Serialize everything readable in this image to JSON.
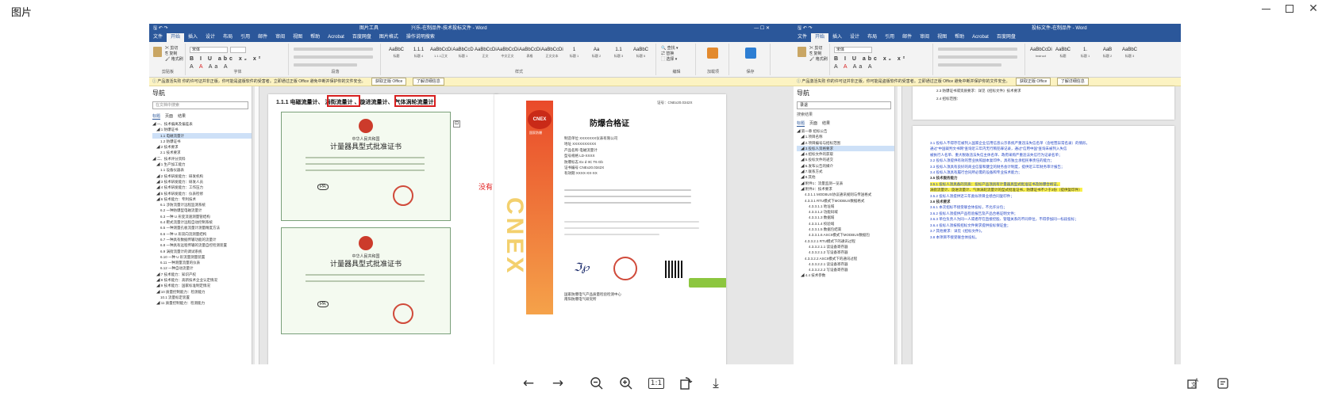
{
  "viewer": {
    "title": "图片",
    "toolbar": [
      "arrow-left-icon",
      "arrow-right-icon",
      "zoom-out-icon",
      "zoom-in-icon",
      "actual-size-icon",
      "rotate-icon",
      "download-icon"
    ],
    "actual_size_label": "1:1"
  },
  "word_left": {
    "title": "兴乐-在制品件-技术投标文件 - Word",
    "menu": [
      "文件",
      "开始",
      "插入",
      "设计",
      "布局",
      "引用",
      "邮件",
      "审阅",
      "视图",
      "帮助",
      "Acrobat",
      "百度网盘",
      "图片格式",
      "操作说明搜索"
    ],
    "active_menu": "开始",
    "font_name": "宋体",
    "ribbon_groups": [
      "剪贴板",
      "字体",
      "段落",
      "样式",
      "编辑",
      "加载项",
      "保存"
    ],
    "styles": [
      {
        "sample": "AaBbC",
        "name": "标题"
      },
      {
        "sample": "1.1.1",
        "name": "标题 4"
      },
      {
        "sample": "AaBbCcDi",
        "name": "1.1.1正文"
      },
      {
        "sample": "AaBbCcD",
        "name": "标题 1"
      },
      {
        "sample": "AaBbCcDi",
        "name": "正文"
      },
      {
        "sample": "AaBbCcDi",
        "name": "中文正文"
      },
      {
        "sample": "AaBbCcDi",
        "name": "表格"
      },
      {
        "sample": "AaBbCcDi",
        "name": "正文文本"
      },
      {
        "sample": "1",
        "name": "标题 1"
      },
      {
        "sample": "Aa",
        "name": "标题 2"
      },
      {
        "sample": "1.1",
        "name": "标题 3"
      },
      {
        "sample": "AaBbC",
        "name": "标题 5"
      }
    ],
    "notice": "产品激活失败  你的许可证并非正版，你可能是盗版软件的受害者。立即通过正版 Office 避免中断并保护你的文件安全。",
    "notice_btn1": "获取正版 Office",
    "notice_btn2": "了解详细信息",
    "nav": {
      "title": "导航",
      "search_placeholder": "在文档中搜索",
      "tabs": [
        "标题",
        "页面",
        "结果"
      ],
      "items": [
        {
          "text": "一、技术偏离及偏差表",
          "level": 0
        },
        {
          "text": "1 防爆证书",
          "level": 1
        },
        {
          "text": "1.1 电磁流量计",
          "level": 2,
          "hl": true
        },
        {
          "text": "1.2 防爆证书",
          "level": 2
        },
        {
          "text": "2 技术要求",
          "level": 1
        },
        {
          "text": "2.1 技术要求",
          "level": 2
        },
        {
          "text": "二、技术评分资料",
          "level": 0
        },
        {
          "text": "1 生产加工能力",
          "level": 1
        },
        {
          "text": "1.1 设备仪器表",
          "level": 2
        },
        {
          "text": "2 技术研发能力：研发机构",
          "level": 1
        },
        {
          "text": "3 技术研发能力：研发人员",
          "level": 1
        },
        {
          "text": "4 技术研发能力：工作压力",
          "level": 1
        },
        {
          "text": "5 技术研发能力：仪表检修",
          "level": 1
        },
        {
          "text": "6 技术能力：专利技术",
          "level": 1
        },
        {
          "text": "6.1 涉防流量计远程监测系统",
          "level": 2
        },
        {
          "text": "6.2 一种防爆型电磁流量计",
          "level": 2
        },
        {
          "text": "6.3 一种 U 形变流速测量管结构",
          "level": 2
        },
        {
          "text": "6.4 靶式流量计远程自动控制系统",
          "level": 2
        },
        {
          "text": "6.5 一种测量孔板流量计测量精度方法",
          "level": 2
        },
        {
          "text": "6.6 一种 U 形双向流测量结构",
          "level": 2
        },
        {
          "text": "6.7 一种具有数据传输功能的流量计",
          "level": 2
        },
        {
          "text": "6.8 一种具有远程传输的流量自控检测装置",
          "level": 2
        },
        {
          "text": "6.9 涡街流量计的调试系统",
          "level": 2
        },
        {
          "text": "6.10 一种 U 形流量测量装置",
          "level": 2
        },
        {
          "text": "6.11 一种测量流量的仪表",
          "level": 2
        },
        {
          "text": "6.12 一种自动流量计",
          "level": 2
        },
        {
          "text": "7 技术能力：知识产权",
          "level": 1
        },
        {
          "text": "8 技术能力：高新技术企业认定情况",
          "level": 1
        },
        {
          "text": "9 技术能力：国家标准制定情况",
          "level": 1
        },
        {
          "text": "10 质量控制能力：检测能力",
          "level": 1
        },
        {
          "text": "10.1 流量标定装置",
          "level": 2
        },
        {
          "text": "11 质量控制能力：检测能力",
          "level": 1
        }
      ]
    },
    "page1": {
      "heading_prefix": "1.1.1 电磁流量计、",
      "boxed1": "涡街流量计",
      "mid": "、旋进流量计、",
      "boxed2": "气体涡轮流量计",
      "cert_country": "中华人民共和国",
      "cert_title": "计量器具型式批准证书",
      "cert_mark": "PA"
    },
    "annotation": "没有",
    "page2": {
      "logo_text": "CNEX",
      "logo_sub": "国家防爆",
      "cert_no": "证号：CNEx20.0342X",
      "title": "防爆合格证",
      "rows": [
        {
          "k": "制造单位",
          "v": "XXXXXXX仪表有限公司"
        },
        {
          "k": "地址",
          "v": "XXXXXXXXXX"
        },
        {
          "k": "产品名称",
          "v": "电磁流量计"
        },
        {
          "k": "型号规格",
          "v": "LD-XXXX"
        },
        {
          "k": "防爆标志",
          "v": "Ex d IIC T6 Gb"
        },
        {
          "k": "证书编号",
          "v": "CNEx20.0342X"
        },
        {
          "k": "有效期",
          "v": "XXXX-XX-XX"
        }
      ],
      "org": "国家防爆电气产品质量检验检测中心",
      "org2": "南阳防爆电气研究所"
    }
  },
  "word_right": {
    "title": "投标文件-在制品件 - Word",
    "menu": [
      "文件",
      "开始",
      "插入",
      "设计",
      "布局",
      "引用",
      "邮件",
      "审阅",
      "视图",
      "帮助",
      "Acrobat",
      "百度网盘"
    ],
    "active_menu": "开始",
    "font_name": "宋体",
    "styles": [
      {
        "sample": "AaBbCcDi",
        "name": "Instruct"
      },
      {
        "sample": "AaBbC",
        "name": "标题"
      },
      {
        "sample": "1.",
        "name": "标题 1"
      },
      {
        "sample": "AaB",
        "name": "标题 2"
      },
      {
        "sample": "AaBbC",
        "name": "标题 3"
      }
    ],
    "notice": "产品激活失败  你的许可证并非正版，你可能是盗版软件的受害者。立即通过正版 Office 避免中断并保护你的文件安全。",
    "notice_btn1": "获取正版 Office",
    "notice_btn2": "了解详细信息",
    "nav": {
      "title": "导航",
      "search_value": "录退",
      "sub": "搜索结果",
      "tabs": [
        "标题",
        "页面",
        "结果"
      ],
      "items": [
        {
          "text": "第一章 招标公告",
          "level": 0
        },
        {
          "text": "1.项目名称",
          "level": 1
        },
        {
          "text": "2.项目编号与招标范围",
          "level": 1
        },
        {
          "text": "3.投标人资格要求",
          "level": 1,
          "hl": true
        },
        {
          "text": "4.招标文件的获取",
          "level": 1
        },
        {
          "text": "5.投标文件的递交",
          "level": 1
        },
        {
          "text": "6.发布公告的媒介",
          "level": 1
        },
        {
          "text": "7.联系方式",
          "level": 1
        },
        {
          "text": "8.其他",
          "level": 1
        },
        {
          "text": "附件1：流量监测一览表",
          "level": 1
        },
        {
          "text": "附件2：技术要求",
          "level": 1
        },
        {
          "text": "4.3.1.1 MODBUS协议通讯规则与传送格式",
          "level": 2
        },
        {
          "text": "4.3.3.1 RTU模式下MODBUS数据格式",
          "level": 2
        },
        {
          "text": "4.3.3.1.1 地址域",
          "level": 3
        },
        {
          "text": "4.3.3.1.2 功能码域",
          "level": 3
        },
        {
          "text": "4.3.3.1.3 数据域",
          "level": 3
        },
        {
          "text": "4.3.3.1.4 校验域",
          "level": 3
        },
        {
          "text": "4.3.3.1.5 数据包结束",
          "level": 3
        },
        {
          "text": "4.3.3.1.6 ASCII模式下MODBUS数据包",
          "level": 3
        },
        {
          "text": "4.3.3.2.1 RTU模式下的通讯过程",
          "level": 2
        },
        {
          "text": "4.3.3.2.1.1 读设备寄存器",
          "level": 3
        },
        {
          "text": "4.3.3.2.1.2 写设备寄存器",
          "level": 3
        },
        {
          "text": "4.3.3.2.2 ASCII模式下的通讯过程",
          "level": 2
        },
        {
          "text": "4.3.3.2.2.1 读设备寄存器",
          "level": 3
        },
        {
          "text": "4.3.3.2.2.2 写设备寄存器",
          "level": 3
        },
        {
          "text": "4.4 技术参数",
          "level": 1
        }
      ]
    },
    "doc_lines": [
      {
        "text": "2.3 防爆证书或资质要求：详见《招标文件》技术要求",
        "cls": ""
      },
      {
        "text": "2.4 招标范围：",
        "cls": ""
      },
      {
        "text": "3.1 投标人不得存在被列入国家企业信用信息公示系统严重违法失信名单（含经营异常名录）的情形。",
        "cls": "blue"
      },
      {
        "text": "通过“中国裁判文书网”查询近三年内无行贿犯罪记录，通过“信用中国”查询未被列入失信",
        "cls": "blue"
      },
      {
        "text": "被执行人名单、重大税收违法失信主体名单、政府采购严重违法失信行为记录名单；",
        "cls": "blue"
      },
      {
        "text": "3.2 投标人须提供有效的营业执照副本复印件，具有独立承担民事责任的能力；",
        "cls": "blue"
      },
      {
        "text": "3.3 投标人须具有良好的商业信誉和健全的财务会计制度，提供近三年财务审计报告；",
        "cls": "blue"
      },
      {
        "text": "3.4 投标人须具有履行合同所必需的设备和专业技术能力；",
        "cls": "blue"
      },
      {
        "text": "3.5 技术服务能力",
        "cls": "bold"
      },
      {
        "text": "3.5.1 投标人须具备的资质：投标产品须具有计量器具型式批准证书及防爆合格证，",
        "cls": "blue yhl"
      },
      {
        "text": "涡街流量计、旋进流量计、气体涡轮流量计的型式批准证书，防爆证书不少于3份（提供复印件）",
        "cls": "yhl"
      },
      {
        "text": "3.5.2 投标人须提供近三年类似项目业绩合同复印件；",
        "cls": "blue"
      },
      {
        "text": "3.6 技术要求",
        "cls": "bold"
      },
      {
        "text": "3.6.1 本次招标不接受联合体投标，不允许分包；",
        "cls": "blue"
      },
      {
        "text": "3.6.2 投标人须提供产品检验报告及产品合格证明文件；",
        "cls": "blue"
      },
      {
        "text": "3.6.3 单位负责人为同一人或者存在直接控股、管理关系的不同单位，不得参加同一标段投标；",
        "cls": "blue"
      },
      {
        "text": "3.6.4 投标人须按照招标文件要求提供投标保证金；",
        "cls": "blue"
      },
      {
        "text": "3.7 其他要求：详见《招标文件》。",
        "cls": "blue"
      },
      {
        "text": "3.8 本项目不接受联合体投标。",
        "cls": "blue"
      }
    ]
  }
}
